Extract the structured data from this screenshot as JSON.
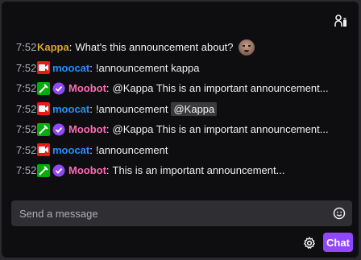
{
  "header": {
    "users_icon": "community-users-icon"
  },
  "colors": {
    "kappa": "#daa520",
    "moocat": "#1e90ff",
    "moobot": "#ff69b4",
    "chat_button": "#9147ff",
    "broadcaster_badge": "#e91916",
    "moderator_badge": "#00ad03",
    "verified_badge": "#9147ff"
  },
  "messages": [
    {
      "time": "7:52",
      "user": "Kappa",
      "sep": ":",
      "text": "What's this announcement about?"
    },
    {
      "time": "7:52",
      "user": "moocat",
      "sep": ":",
      "text": "!announcement kappa"
    },
    {
      "time": "7:52",
      "user": "Moobot",
      "sep": ":",
      "text": "@Kappa This is an important announcement..."
    },
    {
      "time": "7:52",
      "user": "moocat",
      "sep": ":",
      "text": "!announcement",
      "mention": "@Kappa"
    },
    {
      "time": "7:52",
      "user": "Moobot",
      "sep": ":",
      "text": "@Kappa This is an important announcement..."
    },
    {
      "time": "7:52",
      "user": "moocat",
      "sep": ":",
      "text": "!announcement"
    },
    {
      "time": "7:52",
      "user": "Moobot",
      "sep": ":",
      "text": "This is an important announcement..."
    }
  ],
  "input": {
    "placeholder": "Send a message"
  },
  "actions": {
    "chat_label": "Chat"
  }
}
